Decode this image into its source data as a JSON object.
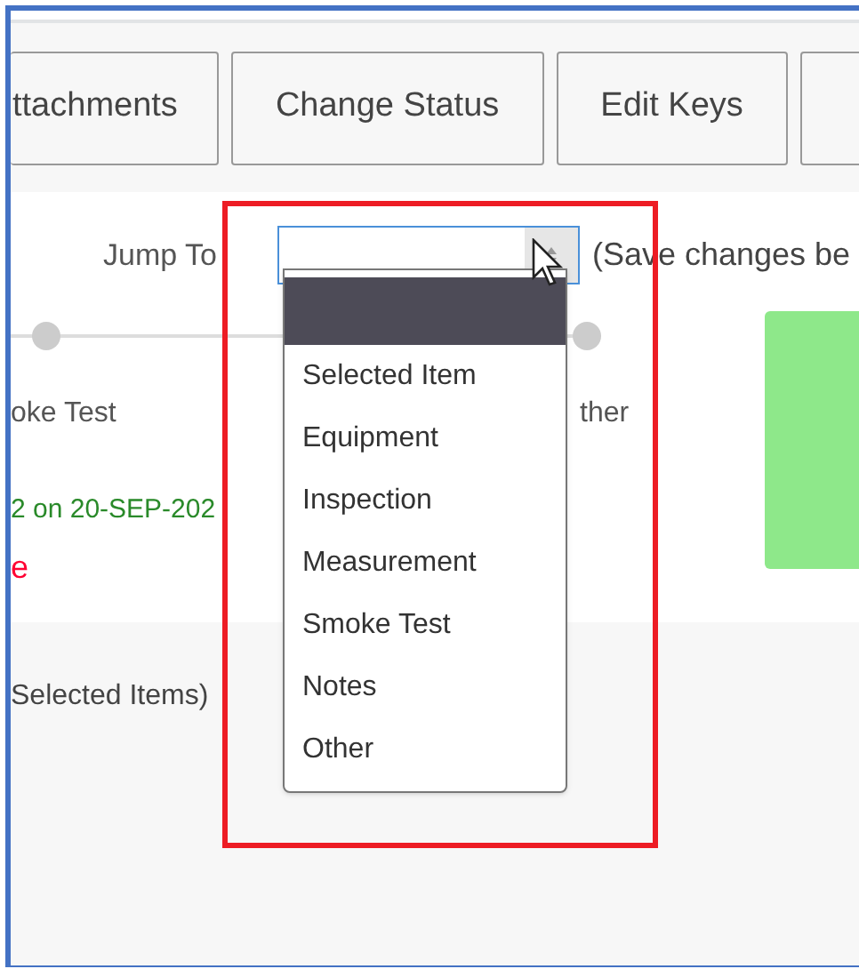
{
  "toolbar": {
    "buttons": [
      {
        "label": "ttachments"
      },
      {
        "label": "Change Status"
      },
      {
        "label": "Edit Keys"
      }
    ]
  },
  "jump_to": {
    "label": "Jump To",
    "note": "(Save changes be",
    "expanded": true,
    "options": [
      {
        "selected": true
      },
      {
        "label": "Selected Item",
        "selected": false
      },
      {
        "label": "Equipment",
        "selected": false
      },
      {
        "label": "Inspection",
        "selected": false
      },
      {
        "label": "Measurement",
        "selected": false
      },
      {
        "label": "Smoke Test",
        "selected": false
      },
      {
        "label": "Notes",
        "selected": false
      },
      {
        "label": "Other",
        "selected": false
      }
    ]
  },
  "steps": [
    {
      "label": "oke Test"
    },
    {
      "label": "ther"
    }
  ],
  "status": {
    "text": "2 on 20-SEP-202",
    "link": "e"
  },
  "lower": {
    "text": "Selected Items)"
  },
  "highlight": {
    "color": "#ed1c24"
  }
}
